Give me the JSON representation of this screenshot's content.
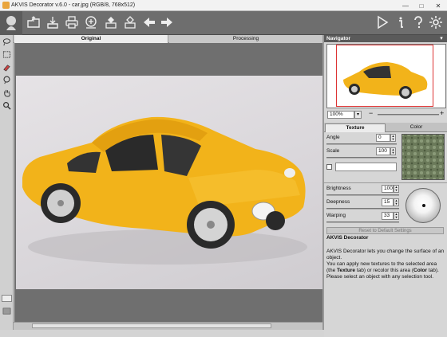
{
  "window": {
    "title": "AKVIS Decorator v.6.0 - car.jpg (RGB/8, 768x512)",
    "min": "—",
    "max": "□",
    "close": "✕"
  },
  "toolbar": {
    "icons": [
      "open-icon",
      "save-icon",
      "print-icon",
      "share-icon",
      "import-preset-icon",
      "export-preset-icon",
      "undo-icon",
      "redo-icon"
    ],
    "right_icons": [
      "run-icon",
      "info-icon",
      "help-icon",
      "settings-icon"
    ]
  },
  "preview_tabs": {
    "original": "Original",
    "processing": "Processing"
  },
  "navigator": {
    "title": "Navigator",
    "zoom": "100%"
  },
  "settings_tabs": {
    "texture": "Texture",
    "color": "Color"
  },
  "texture": {
    "angle_label": "Angle",
    "angle_value": "0",
    "scale_label": "Scale",
    "scale_value": "100",
    "brightness_label": "Brightness",
    "brightness_value": "100",
    "deepness_label": "Deepness",
    "deepness_value": "15",
    "warping_label": "Warping",
    "warping_value": "33",
    "reset": "Reset to Default Settings"
  },
  "help": {
    "title": "AKVIS Decorator",
    "p1": "AKVIS Decorator lets you change the surface of an object.",
    "p2a": "You can apply new textures to the selected area (the ",
    "p2b": "Texture",
    "p2c": " tab) or recolor this area (",
    "p2d": "Color",
    "p2e": " tab).",
    "p3": "Please select an object with any selection tool."
  },
  "colors": {
    "toolbar": "#6e6e6e",
    "car": "#f2b31a",
    "panel_head": "#5a5a5a"
  }
}
